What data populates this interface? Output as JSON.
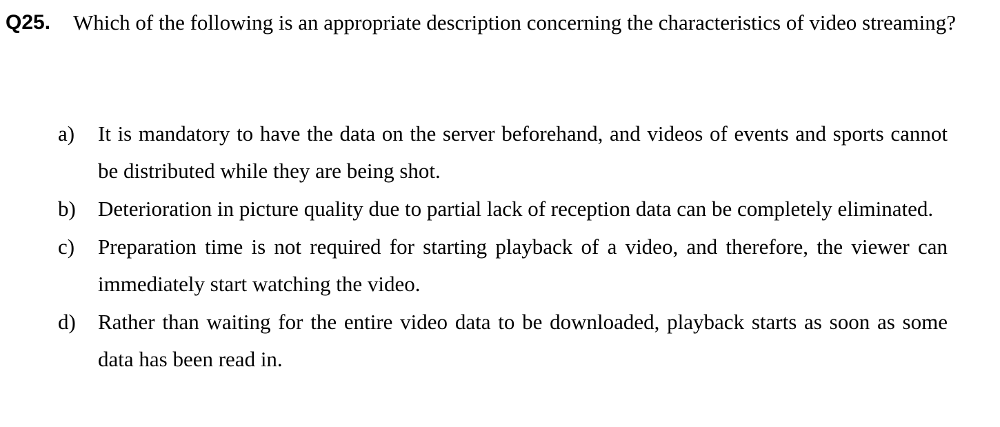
{
  "question": {
    "number": "Q25.",
    "text": "Which of the following is an appropriate description concerning the characteristics of video streaming?"
  },
  "options": [
    {
      "letter": "a)",
      "text": "It is mandatory to have the data on the server beforehand, and videos of events and sports cannot be distributed while they are being shot."
    },
    {
      "letter": "b)",
      "text": "Deterioration in picture quality due to partial lack of reception data can be completely eliminated."
    },
    {
      "letter": "c)",
      "text": "Preparation time is not required for starting playback of a video, and therefore, the viewer can immediately start watching the video."
    },
    {
      "letter": "d)",
      "text": "Rather than waiting for the entire video data to be downloaded, playback starts as soon as some data has been read in."
    }
  ]
}
